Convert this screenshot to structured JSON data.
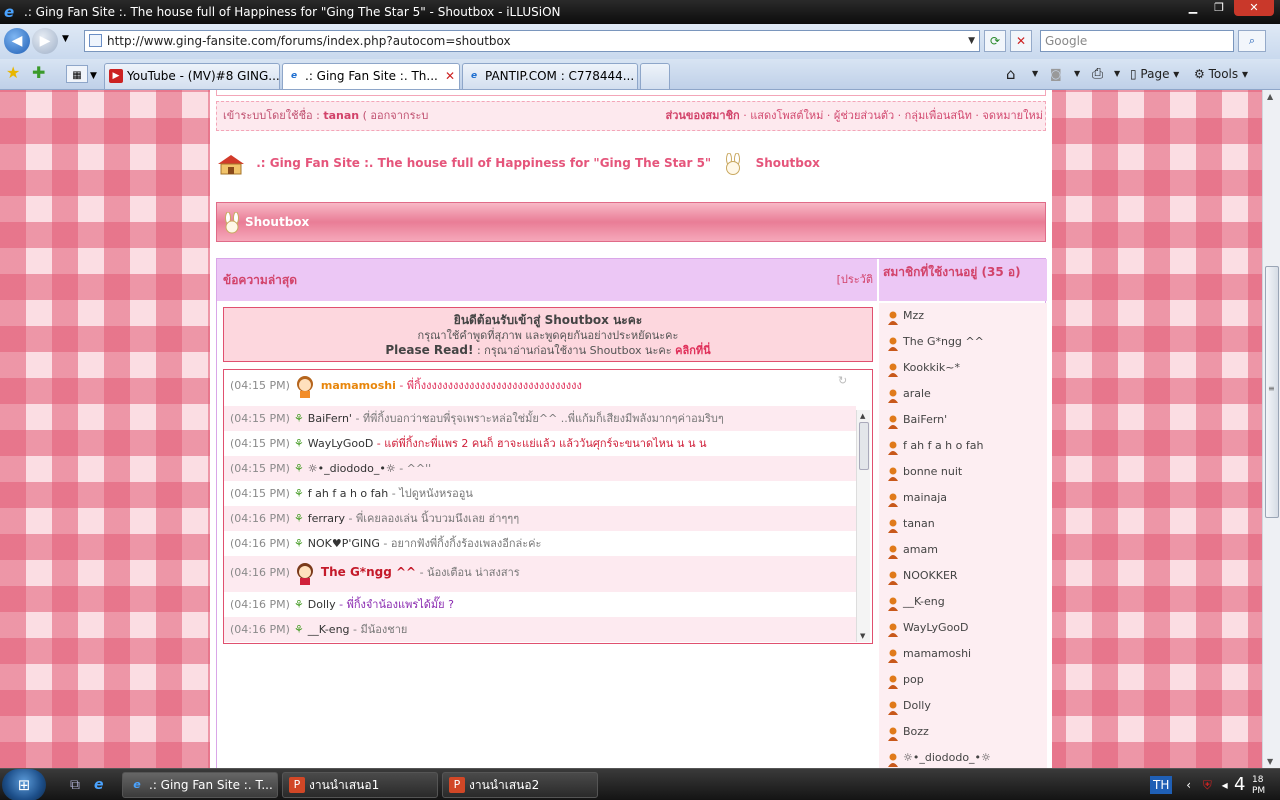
{
  "window": {
    "title": ".: Ging Fan Site :. The house full of Happiness for \"Ging The Star 5\" - Shoutbox - iLLUSiON"
  },
  "toolbar": {
    "url": "http://www.ging-fansite.com/forums/index.php?autocom=shoutbox",
    "search_placeholder": "Google"
  },
  "tabs": [
    {
      "label": "YouTube - (MV)#8 GING..."
    },
    {
      "label": ".: Ging Fan Site :. Th..."
    },
    {
      "label": "PANTIP.COM : C778444..."
    }
  ],
  "commands": {
    "page": "Page",
    "tools": "Tools"
  },
  "forum": {
    "login_prefix": "เข้าระบบโดยใช้ชื่อ :",
    "username": "tanan",
    "logout": "( ออกจากระบ",
    "member_area": "ส่วนของสมาชิก",
    "member_links": "· แสดงโพสต์ใหม่ · ผู้ช่วยส่วนตัว · กลุ่มเพื่อนสนิท · จดหมายใหม่",
    "breadcrumb_site": ".: Ging Fan Site :. The house full of Happiness for \"Ging The Star 5\"",
    "breadcrumb_page": "Shoutbox",
    "header": "Shoutbox",
    "latest_label": "ข้อความล่าสุด",
    "history_label": "[ประวัติ",
    "online_label": "สมาชิกที่ใช้งานอยู่ (35 อ)"
  },
  "welcome": {
    "line1": "ยินดีต้อนรับเข้าสู่ Shoutbox นะคะ",
    "line2": "กรุณาใช้คำพูดที่สุภาพ และพูดคุยกันอย่างประหยัดนะคะ",
    "line3_bold": "Please Read!",
    "line3_text": ": กรุณาอ่านก่อนใช้งาน Shoutbox นะคะ",
    "line3_link": "คลิกที่นี่"
  },
  "messages": [
    {
      "time": "(04:15 PM)",
      "name": "mamamoshi",
      "text": "- พี่กิ้งงงงงงงงงงงงงงงงงงงงงงงงงงงงงง"
    },
    {
      "time": "(04:15 PM)",
      "name": "BaiFern'",
      "text": "- ที่พี่กิ้งบอกว่าชอบพี่รุจเพราะหล่อใช่มั้ย^^ ..พี่แก้มก็เสียงมีพลังมากๆค่าอมริบๆ"
    },
    {
      "time": "(04:15 PM)",
      "name": "WayLyGooD",
      "text": "- แต่พี่กิ้งกะพี่แพร 2 คนก็ ฮาจะแย่แล้ว แล้ววันศุกร์จะขนาดไหน น น น"
    },
    {
      "time": "(04:15 PM)",
      "name": "☼•_diododo_•☼",
      "text": "- ^^''"
    },
    {
      "time": "(04:15 PM)",
      "name": "f ah f a h o fah",
      "text": "- ไปดูหนังหรออูน"
    },
    {
      "time": "(04:16 PM)",
      "name": "ferrary",
      "text": "- พี่เคยลองเล่น นิ้วบวมนึงเลย ฮ่าๆๆๆ"
    },
    {
      "time": "(04:16 PM)",
      "name": "NOK♥P'GING",
      "text": "- อยากฟังพี่กิ้งกิ้งร้องเพลงอีกล่ะค่ะ"
    },
    {
      "time": "(04:16 PM)",
      "name": "The G*ngg ^^",
      "text": "- น้องเตือน น่าสงสาร"
    },
    {
      "time": "(04:16 PM)",
      "name": "Dolly",
      "text": "- พี่กิ้งจำน้องแพรได้มั๊ย ?"
    },
    {
      "time": "(04:16 PM)",
      "name": "__K-eng",
      "text": "- มีน้องชาย"
    }
  ],
  "online_users": [
    "Mzz",
    "The G*ngg ^^",
    "Kookkik~*",
    "arale",
    "BaiFern'",
    "f ah f a h o fah",
    "bonne nuit",
    "mainaja",
    "tanan",
    "amam",
    "NOOKKER",
    "__K-eng",
    "WayLyGooD",
    "mamamoshi",
    "pop",
    "Dolly",
    "Bozz",
    "☼•_diododo_•☼"
  ],
  "taskbar": {
    "items": [
      {
        "label": ".: Ging Fan Site :. T..."
      },
      {
        "label": "งานนำเสนอ1"
      },
      {
        "label": "งานนำเสนอ2"
      }
    ],
    "lang": "TH",
    "time": "4",
    "time_small": "18",
    "ampm": "PM"
  },
  "colors": {
    "accent": "#e5557b",
    "message_pink": "#e0305a",
    "message_purple": "#8a2ab0",
    "message_orange": "#e8860b"
  }
}
